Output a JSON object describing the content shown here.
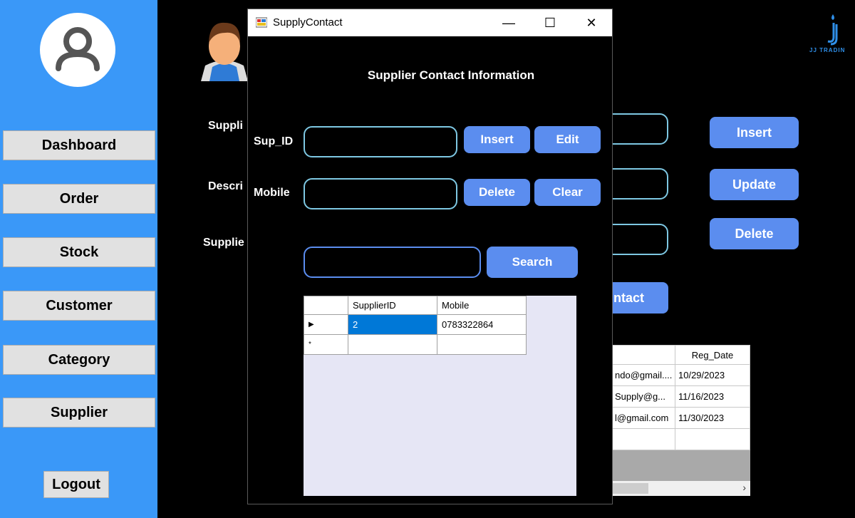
{
  "sidebar": {
    "avatar_icon": "user-icon",
    "nav": [
      {
        "label": "Dashboard"
      },
      {
        "label": "Order"
      },
      {
        "label": "Stock"
      },
      {
        "label": "Customer"
      },
      {
        "label": "Category"
      },
      {
        "label": "Supplier"
      }
    ],
    "logout_label": "Logout"
  },
  "background_form": {
    "labels": [
      "Suppli",
      "Descri",
      "Supplie"
    ],
    "buttons": {
      "insert": "Insert",
      "update": "Update",
      "delete": "Delete",
      "contact": "ntact"
    },
    "brand_text": "JJ TRADIN",
    "grid": {
      "columns": [
        "",
        "Reg_Date"
      ],
      "rows": [
        [
          "ndo@gmail....",
          "10/29/2023"
        ],
        [
          "Supply@g...",
          "11/16/2023"
        ],
        [
          "l@gmail.com",
          "11/30/2023"
        ],
        [
          "",
          ""
        ]
      ]
    }
  },
  "window": {
    "title": "SupplyContact",
    "controls": {
      "minimize": "—",
      "maximize": "☐",
      "close": "✕"
    },
    "heading": "Supplier Contact Information",
    "sup_id_label": "Sup_ID",
    "mobile_label": "Mobile",
    "sup_id_value": "",
    "mobile_value": "",
    "search_value": "",
    "buttons": {
      "insert": "Insert",
      "edit": "Edit",
      "delete": "Delete",
      "clear": "Clear",
      "search": "Search"
    },
    "grid": {
      "columns": [
        "SupplierID",
        "Mobile"
      ],
      "rows": [
        {
          "marker": "▶",
          "supplier_id": "2",
          "mobile": "0783322864"
        },
        {
          "marker": "*",
          "supplier_id": "",
          "mobile": ""
        }
      ]
    }
  },
  "colors": {
    "sidebar": "#3a98f8",
    "button": "#5b8def",
    "input_border": "#7ec8e3",
    "selection": "#0078d7"
  }
}
